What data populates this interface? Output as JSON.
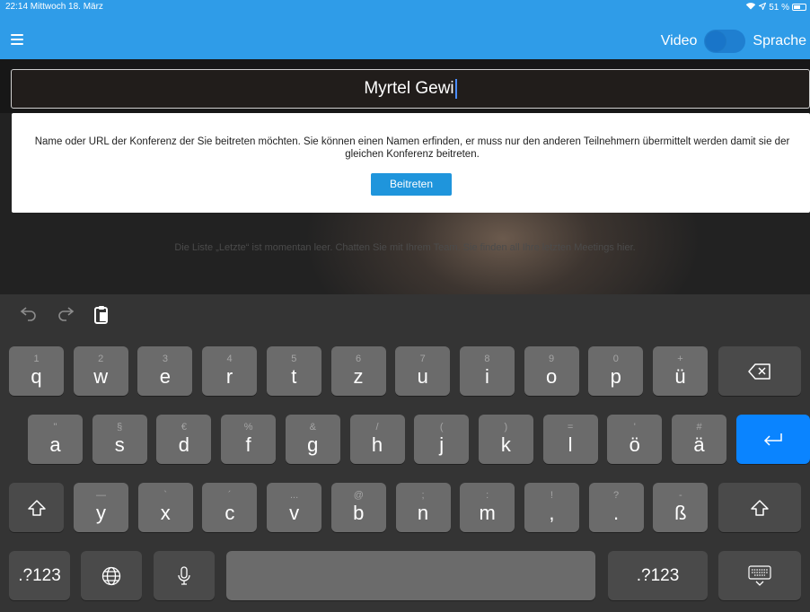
{
  "status": {
    "time_date": "22:14  Mittwoch 18. März",
    "battery": "51 %"
  },
  "header": {
    "video_label": "Video",
    "audio_label": "Sprache"
  },
  "room": {
    "value": "Myrtel Gewi"
  },
  "info": {
    "text": "Name oder URL der Konferenz der Sie beitreten möchten. Sie können einen Namen erfinden, er muss nur den anderen Teilnehmern übermittelt werden damit sie der gleichen Konferenz beitreten.",
    "join_label": "Beitreten"
  },
  "recent": {
    "empty_text": "Die Liste „Letzte“ ist momentan leer. Chatten Sie mit Ihrem Team. Sie finden all Ihre letzten Meetings hier."
  },
  "keyboard": {
    "row1": [
      {
        "alt": "1",
        "main": "q"
      },
      {
        "alt": "2",
        "main": "w"
      },
      {
        "alt": "3",
        "main": "e"
      },
      {
        "alt": "4",
        "main": "r"
      },
      {
        "alt": "5",
        "main": "t"
      },
      {
        "alt": "6",
        "main": "z"
      },
      {
        "alt": "7",
        "main": "u"
      },
      {
        "alt": "8",
        "main": "i"
      },
      {
        "alt": "9",
        "main": "o"
      },
      {
        "alt": "0",
        "main": "p"
      },
      {
        "alt": "+",
        "main": "ü"
      }
    ],
    "row2": [
      {
        "alt": "\"",
        "main": "a"
      },
      {
        "alt": "§",
        "main": "s"
      },
      {
        "alt": "€",
        "main": "d"
      },
      {
        "alt": "%",
        "main": "f"
      },
      {
        "alt": "&",
        "main": "g"
      },
      {
        "alt": "/",
        "main": "h"
      },
      {
        "alt": "(",
        "main": "j"
      },
      {
        "alt": ")",
        "main": "k"
      },
      {
        "alt": "=",
        "main": "l"
      },
      {
        "alt": "'",
        "main": "ö"
      },
      {
        "alt": "#",
        "main": "ä"
      }
    ],
    "row3": [
      {
        "alt": "—",
        "main": "y"
      },
      {
        "alt": "`",
        "main": "x"
      },
      {
        "alt": "´",
        "main": "c"
      },
      {
        "alt": "...",
        "main": "v"
      },
      {
        "alt": "@",
        "main": "b"
      },
      {
        "alt": ";",
        "main": "n"
      },
      {
        "alt": ":",
        "main": "m"
      },
      {
        "alt": "!",
        "main": ","
      },
      {
        "alt": "?",
        "main": "."
      },
      {
        "alt": "-",
        "main": "ß"
      }
    ],
    "numbers_label": ".?123",
    "colors": {
      "key": "#6b6b6b",
      "function_key": "#4a4a4a",
      "return_key": "#0a84ff"
    }
  },
  "colors": {
    "header": "#2f9ce8",
    "join_button": "#1f95dc"
  }
}
